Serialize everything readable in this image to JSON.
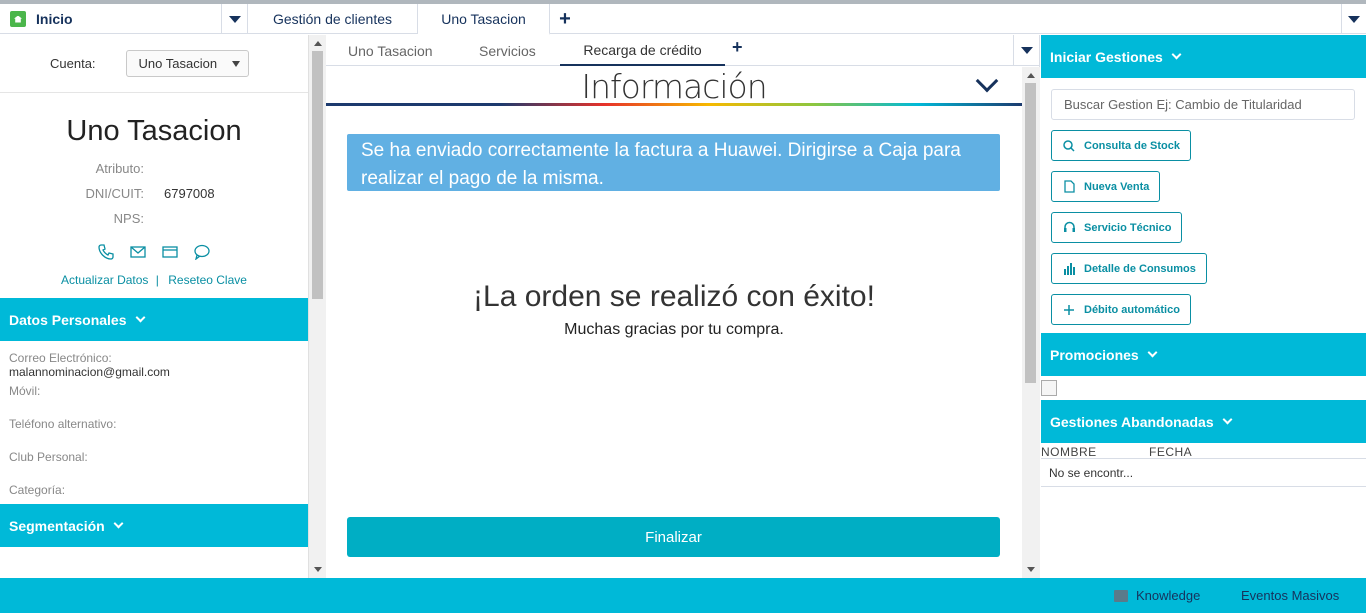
{
  "tabs": {
    "home": "Inicio",
    "gestion": "Gestión de clientes",
    "active": "Uno Tasacion",
    "plus": "+"
  },
  "left": {
    "cuenta_label": "Cuenta:",
    "cuenta_value": "Uno Tasacion",
    "account_name": "Uno Tasacion",
    "attributes": [
      {
        "label": "Atributo:",
        "value": ""
      },
      {
        "label": "DNI/CUIT:",
        "value": "6797008"
      },
      {
        "label": "NPS:",
        "value": ""
      }
    ],
    "link_actualizar": "Actualizar Datos",
    "link_sep": "|",
    "link_reseteo": "Reseteo Clave",
    "datos_personales": "Datos Personales",
    "fields": [
      {
        "label": "Correo Electrónico:",
        "value": "malannominacion@gmail.com"
      },
      {
        "label": "Móvil:",
        "value": ""
      },
      {
        "label": "Teléfono alternativo:",
        "value": ""
      },
      {
        "label": "Club Personal:",
        "value": ""
      },
      {
        "label": "Categoría:",
        "value": ""
      }
    ],
    "segmentacion": "Segmentación"
  },
  "center": {
    "subtabs": [
      "Uno Tasacion",
      "Servicios",
      "Recarga de crédito"
    ],
    "plus": "+",
    "info_title": "Información",
    "alert": "Se ha enviado correctamente la factura a Huawei. Dirigirse a Caja para realizar el pago de la misma.",
    "success_title": "¡La orden se realizó con éxito!",
    "success_sub": "Muchas gracias por tu compra.",
    "finalizar": "Finalizar"
  },
  "right": {
    "iniciar": "Iniciar Gestiones",
    "search_placeholder": "Buscar Gestion Ej: Cambio de Titularidad",
    "buttons": [
      "Consulta de Stock",
      "Nueva Venta",
      "Servicio Técnico",
      "Detalle de Consumos",
      "Débito automático"
    ],
    "promociones": "Promociones",
    "abandonadas": "Gestiones Abandonadas",
    "col_nombre": "NOMBRE",
    "col_fecha": "FECHA",
    "no_result": "No se encontr..."
  },
  "bottom": {
    "knowledge": "Knowledge",
    "eventos": "Eventos Masivos"
  },
  "colors": {
    "accent": "#00b9d8",
    "alert": "#61b0e3",
    "button": "#00aec4",
    "navy": "#16325c"
  }
}
